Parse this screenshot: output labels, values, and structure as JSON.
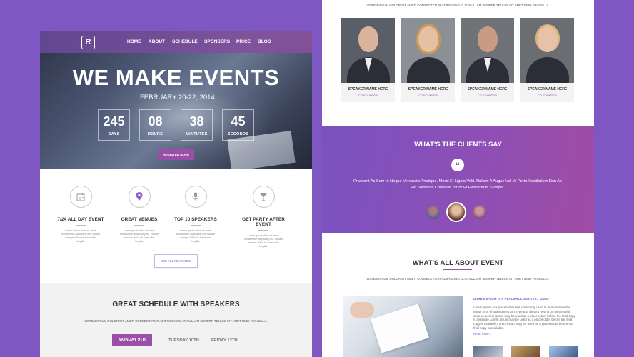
{
  "colors": {
    "background": "#7e57c2",
    "accent": "#9a4fa8"
  },
  "left": {
    "logo": "R",
    "nav": [
      "HOME",
      "ABOUT",
      "SCHEDULE",
      "SPONSERS",
      "PRICE",
      "BLOG"
    ],
    "hero_title": "WE MAKE EVENTS",
    "hero_date": "FEBRUARY 20-22, 2014",
    "countdown": [
      {
        "value": "245",
        "label": "DAYS"
      },
      {
        "value": "08",
        "label": "HOURS"
      },
      {
        "value": "38",
        "label": "MINTUTES"
      },
      {
        "value": "45",
        "label": "SECONDS"
      }
    ],
    "register": "REGISTER NOW!",
    "features": [
      {
        "icon": "calendar-icon",
        "title": "7/24 ALL DAY EVENT",
        "desc": "Lorem ipsum dolor sit amet, consectetur adipiscing elit. Nullam semper tellus sit amet nibh fringilla."
      },
      {
        "icon": "location-pin-icon",
        "title": "GREAT VENUES",
        "desc": "Lorem ipsum dolor sit amet, consectetur adipiscing elit. Nullam semper tellus sit amet nibh fringilla."
      },
      {
        "icon": "microphone-icon",
        "title": "TOP 10 SPEAKERS",
        "desc": "Lorem ipsum dolor sit amet, consectetur adipiscing elit. Nullam semper tellus sit amet nibh fringilla."
      },
      {
        "icon": "cocktail-icon",
        "title": "GET PARTY AFTER EVENT",
        "desc": "Lorem ipsum dolor sit amet, consectetur adipiscing elit. Nullam semper tellus sit amet nibh fringilla."
      }
    ],
    "see_all": "SEE ALL FEATURES",
    "schedule_title": "GREAT SCHEDULE WITH SPEAKERS",
    "schedule_sub": "LOREM IPSUM DOLOR SIT AMET, CONSECTETUR ADIPISCING ELIT. NULLAM SEMPER TELLUS SIT AMET NIBH FRINGILLA.",
    "tabs": [
      "MONDAY 9TH",
      "TUESDAY 10TH",
      "FRIDAY 12TH"
    ]
  },
  "right": {
    "top_sub": "LOREM IPSUM DOLOR SIT AMET, CONSECTETUR ADIPISCING ELIT. NULLAM SEMPER TELLUS SIT AMET NIBH FRINGILLA.",
    "speakers": [
      {
        "name": "SPEAKER NAME HERE",
        "role": "CO FOUNDER"
      },
      {
        "name": "SPEAKER NAME HERE",
        "role": "CO FOUNDER"
      },
      {
        "name": "SPEAKER NAME HERE",
        "role": "CO FOUNDER"
      },
      {
        "name": "SPEAKER NAME HERE",
        "role": "CO FOUNDER"
      }
    ],
    "clients_title": "WHAT'S THE CLIENTS SAY",
    "quote_mark": "“",
    "clients_text": "Praesent Ac Sem In Neque Venenatis Tristique. Morbi Et Ligula Velit. Nullam A Augue Vel Mi Porta Vestibulum Non Ac Elit. Vivamus Convallis Tortor Et Fermentum Semper.",
    "about_title": "WHAT'S ALL ABOUT EVENT",
    "about_sub": "LOREM IPSUM DOLOR SIT AMET, CONSECTETUR ADIPISCING ELIT. NULLAM SEMPER TELLUS SIT AMET NIBH FRINGILLA.",
    "about_heading": "LOREM IPSUM IS A PLACEHOLDER TEXT USED",
    "about_text": "Lorem ipsum is a placeholder text commonly used to demonstrate the visual form of a document or a typeface without relying on meaningful content. Lorem ipsum may be used as a placeholder before the final copy is available.Lorem ipsum may be used as a placeholder before the final copy is available.Lorem ipsum may be used as a placeholder before the final copy is available.",
    "read_more": "Read more..."
  }
}
